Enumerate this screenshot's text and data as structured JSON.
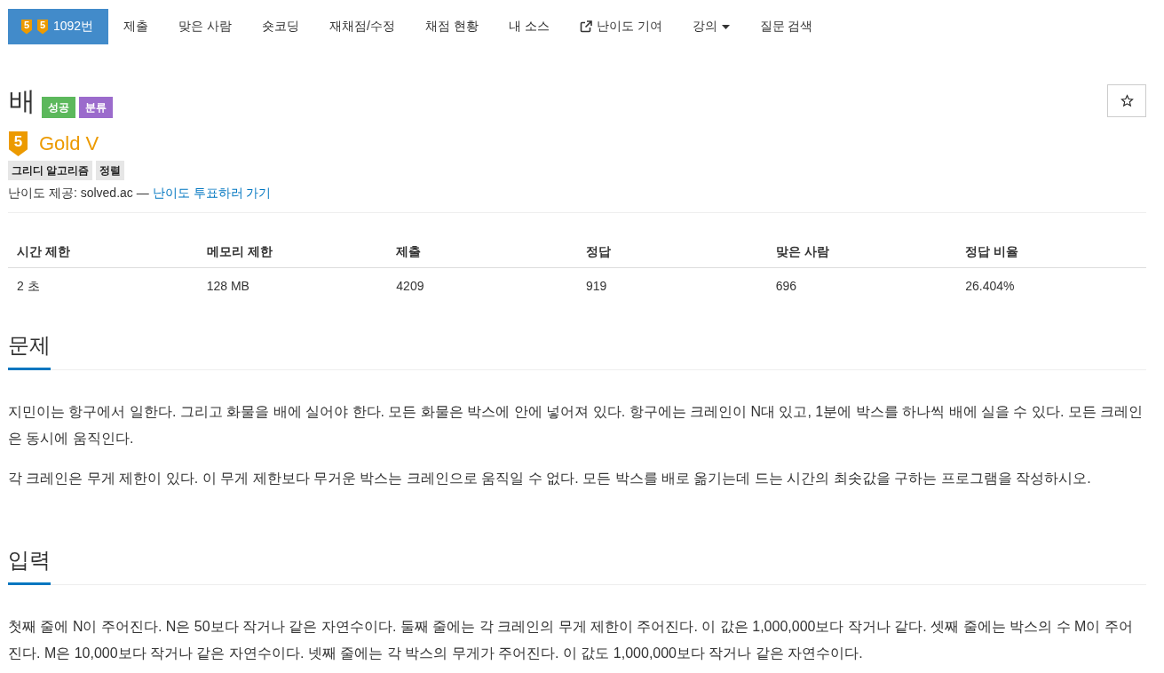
{
  "nav": {
    "items": [
      {
        "kind": "problem",
        "badges": [
          "5",
          "5"
        ],
        "label": "1092번",
        "selected": true
      },
      {
        "kind": "link",
        "label": "제출",
        "selected": false
      },
      {
        "kind": "link",
        "label": "맞은 사람",
        "selected": false
      },
      {
        "kind": "link",
        "label": "숏코딩",
        "selected": false
      },
      {
        "kind": "link",
        "label": "재채점/수정",
        "selected": false
      },
      {
        "kind": "link",
        "label": "채점 현황",
        "selected": false
      },
      {
        "kind": "link",
        "label": "내 소스",
        "selected": false
      },
      {
        "kind": "external",
        "label": "난이도 기여",
        "selected": false
      },
      {
        "kind": "dropdown",
        "label": "강의",
        "selected": false
      },
      {
        "kind": "link",
        "label": "질문 검색",
        "selected": false
      }
    ]
  },
  "problem": {
    "title": "배",
    "labels": [
      {
        "text": "성공",
        "color": "#5cb85c"
      },
      {
        "text": "분류",
        "color": "#9b6bcc"
      }
    ],
    "tier": {
      "badge": "5",
      "name": "Gold V"
    },
    "tags": [
      "그리디 알고리즘",
      "정렬"
    ],
    "difficulty_note": {
      "text": "난이도 제공: solved.ac —",
      "link": "난이도 투표하러 가기"
    }
  },
  "info_table": {
    "columns": [
      "시간 제한",
      "메모리 제한",
      "제출",
      "정답",
      "맞은 사람",
      "정답 비율"
    ],
    "rows": [
      [
        "2 초",
        "128 MB",
        "4209",
        "919",
        "696",
        "26.404%"
      ]
    ]
  },
  "sections": [
    {
      "title": "문제",
      "paragraphs": [
        "지민이는 항구에서 일한다. 그리고 화물을 배에 실어야 한다. 모든 화물은 박스에 안에 넣어져 있다. 항구에는 크레인이 N대 있고, 1분에 박스를 하나씩 배에 실을 수 있다. 모든 크레인은 동시에 움직인다.",
        "각 크레인은 무게 제한이 있다. 이 무게 제한보다 무거운 박스는 크레인으로 움직일 수 없다. 모든 박스를 배로 옮기는데 드는 시간의 최솟값을 구하는 프로그램을 작성하시오."
      ]
    },
    {
      "title": "입력",
      "paragraphs": [
        "첫째 줄에 N이 주어진다. N은 50보다 작거나 같은 자연수이다. 둘째 줄에는 각 크레인의 무게 제한이 주어진다. 이 값은 1,000,000보다 작거나 같다. 셋째 줄에는 박스의 수 M이 주어진다. M은 10,000보다 작거나 같은 자연수이다. 넷째 줄에는 각 박스의 무게가 주어진다. 이 값도 1,000,000보다 작거나 같은 자연수이다."
      ]
    }
  ]
}
